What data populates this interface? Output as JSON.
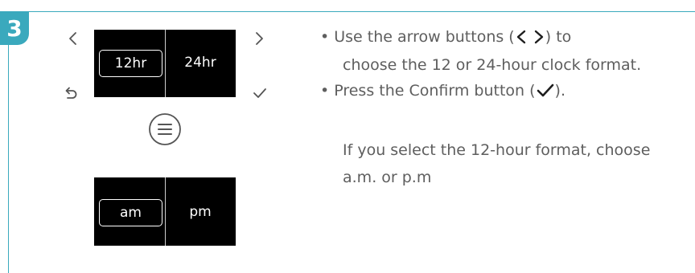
{
  "step": {
    "number": "3"
  },
  "screen_format": {
    "left": "12hr",
    "right": "24hr",
    "selected": "12hr"
  },
  "screen_ampm": {
    "left": "am",
    "right": "pm",
    "selected": "am"
  },
  "icons": {
    "left": "chevron-left-icon",
    "right": "chevron-right-icon",
    "back": "back-arrow-icon",
    "confirm": "checkmark-icon",
    "menu": "menu-icon"
  },
  "instructions": {
    "bullet": "•",
    "line1_before": "Use the arrow buttons (",
    "line1_after": ") to",
    "line2": "choose the 12 or 24-hour clock format.",
    "line3_before": "Press the Confirm button (",
    "line3_after": ").",
    "note_line1": "If you select the 12-hour format, choose",
    "note_line2": "a.m. or p.m"
  },
  "colors": {
    "accent": "#3aa9bd",
    "screen_background": "#000000",
    "text": "#5e5e5e",
    "icon_dark": "#1e1e1e"
  }
}
